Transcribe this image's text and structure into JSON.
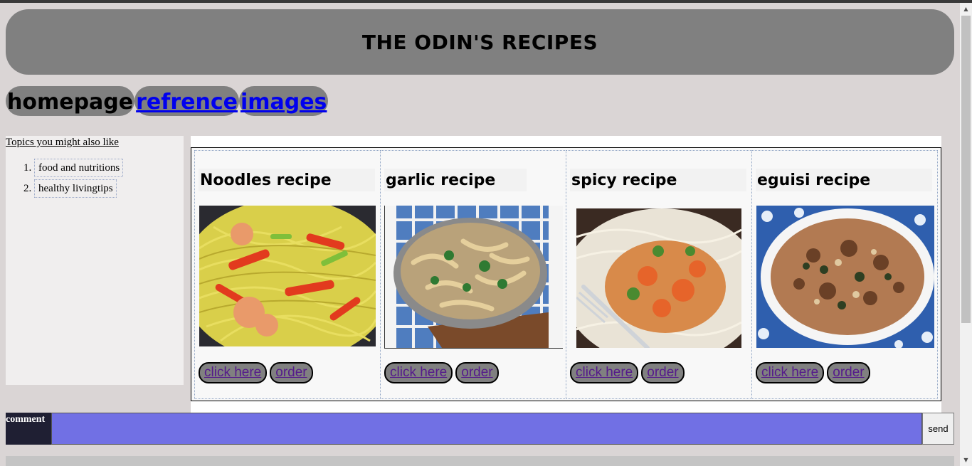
{
  "header": {
    "title": "THE ODIN'S RECIPES"
  },
  "nav": {
    "home": "homepage",
    "reference": "refrence",
    "images": "images"
  },
  "sidebar": {
    "topics_label": "Topics you might also like",
    "items": [
      "food and nutritions",
      "healthy livingtips"
    ]
  },
  "recipes": [
    {
      "title": "Noodles recipe",
      "click": "click here",
      "order": "order"
    },
    {
      "title": "garlic recipe",
      "click": "click here",
      "order": "order"
    },
    {
      "title": "spicy recipe",
      "click": "click here",
      "order": "order"
    },
    {
      "title": "eguisi recipe",
      "click": "click here",
      "order": "order"
    }
  ],
  "comment": {
    "label": "comment",
    "send": "send"
  },
  "colors": {
    "header_bg": "#808080",
    "comment_input_bg": "#7170e4",
    "comment_label_bg": "#1f1f33"
  }
}
